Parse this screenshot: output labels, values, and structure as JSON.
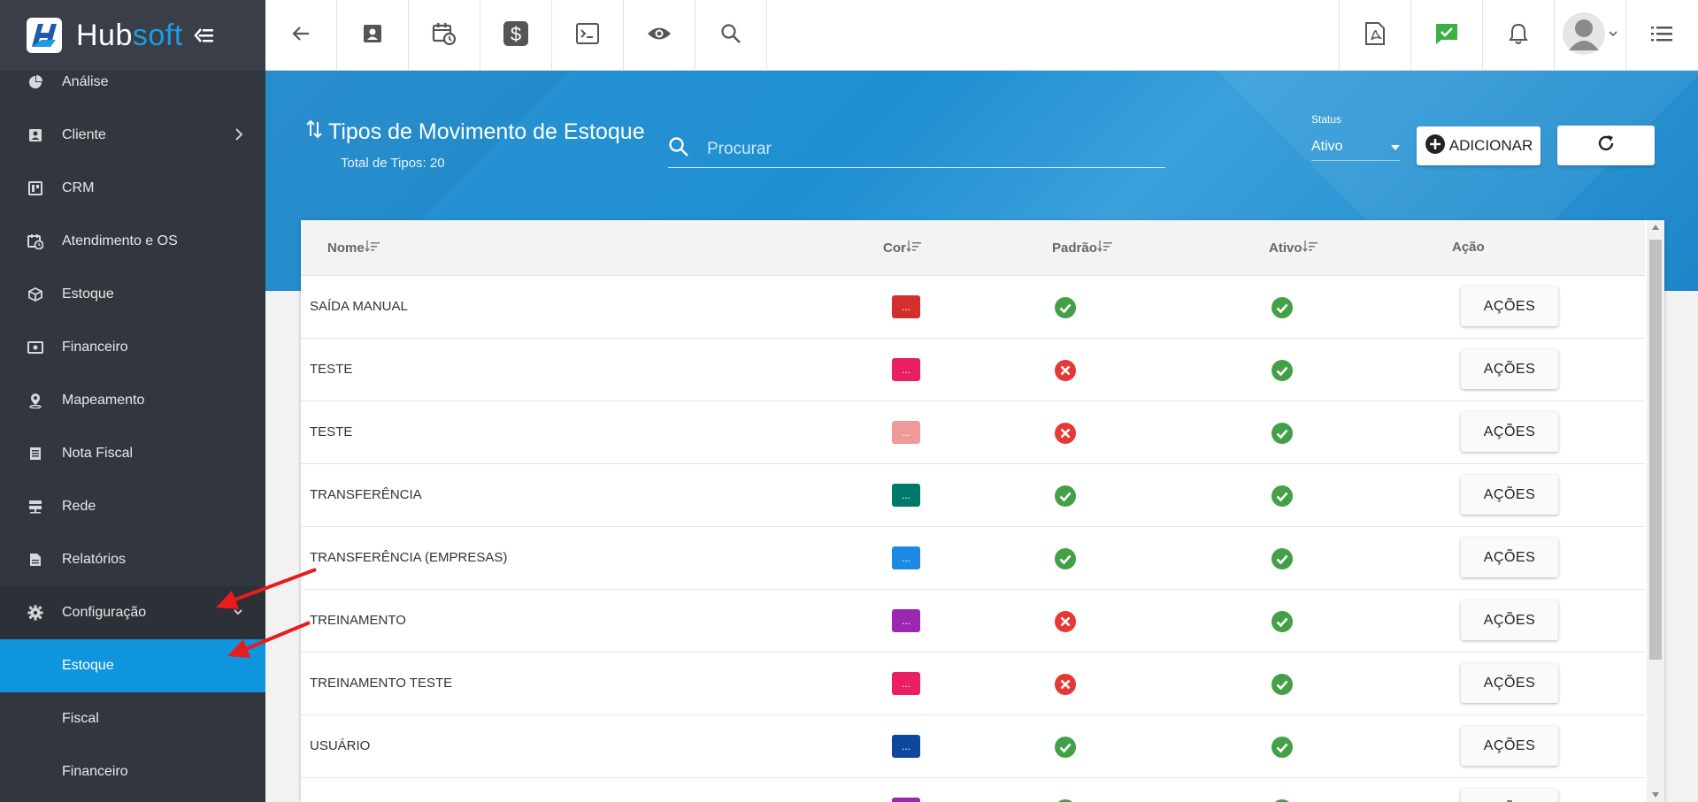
{
  "brand": {
    "name_a": "Hub",
    "name_b": "soft"
  },
  "sidebar": {
    "items": [
      {
        "label": "Análise",
        "icon": "pie-chart-icon"
      },
      {
        "label": "Cliente",
        "icon": "contact-card-icon"
      },
      {
        "label": "CRM",
        "icon": "kanban-board-icon"
      },
      {
        "label": "Atendimento e OS",
        "icon": "calendar-clock-icon"
      },
      {
        "label": "Estoque",
        "icon": "box-icon"
      },
      {
        "label": "Financeiro",
        "icon": "money-bill-icon"
      },
      {
        "label": "Mapeamento",
        "icon": "map-pin-icon"
      },
      {
        "label": "Nota Fiscal",
        "icon": "receipt-icon"
      },
      {
        "label": "Rede",
        "icon": "server-icon"
      },
      {
        "label": "Relatórios",
        "icon": "document-icon"
      },
      {
        "label": "Configuração",
        "icon": "gear-icon"
      }
    ],
    "subitems": [
      {
        "label": "Estoque",
        "active": true
      },
      {
        "label": "Fiscal"
      },
      {
        "label": "Financeiro"
      }
    ]
  },
  "page": {
    "title": "Tipos de Movimento de Estoque",
    "subtitle": "Total de Tipos: 20",
    "search_placeholder": "Procurar",
    "status_label": "Status",
    "status_value": "Ativo",
    "add_label": "ADICIONAR"
  },
  "table": {
    "headers": {
      "nome": "Nome",
      "cor": "Cor",
      "padrao": "Padrão",
      "ativo": "Ativo",
      "acao": "Ação"
    },
    "action_label": "AÇÕES",
    "swatch_label": "...",
    "rows": [
      {
        "nome": "SAÍDA MANUAL",
        "cor": "#d32f2f",
        "padrao": true,
        "ativo": true
      },
      {
        "nome": "TESTE",
        "cor": "#e91e63",
        "padrao": false,
        "ativo": true
      },
      {
        "nome": "TESTE",
        "cor": "#ef9a9a",
        "padrao": false,
        "ativo": true
      },
      {
        "nome": "TRANSFERÊNCIA",
        "cor": "#00796b",
        "padrao": true,
        "ativo": true
      },
      {
        "nome": "TRANSFERÊNCIA (EMPRESAS)",
        "cor": "#1e88e5",
        "padrao": true,
        "ativo": true
      },
      {
        "nome": "TREINAMENTO",
        "cor": "#9c27b0",
        "padrao": false,
        "ativo": true
      },
      {
        "nome": "TREINAMENTO TESTE",
        "cor": "#e91e63",
        "padrao": false,
        "ativo": true
      },
      {
        "nome": "USUÁRIO",
        "cor": "#0d47a1",
        "padrao": true,
        "ativo": true
      },
      {
        "nome": "",
        "cor": "#9c27b0",
        "padrao": true,
        "ativo": true
      }
    ]
  },
  "colors": {
    "sidebar": "#32373f",
    "accent": "#0f95de",
    "check": "#43a047",
    "cross": "#e53935",
    "annotation": "#e81c1c"
  }
}
